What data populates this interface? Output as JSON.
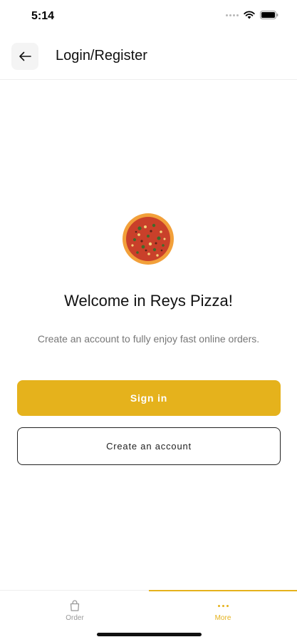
{
  "status_bar": {
    "time": "5:14"
  },
  "header": {
    "title": "Login/Register",
    "back_icon": "arrow-left-icon"
  },
  "main": {
    "logo": "pizza-logo",
    "welcome": "Welcome in Reys Pizza!",
    "subtitle": "Create an account to fully enjoy fast online orders.",
    "sign_in_label": "Sign in",
    "create_account_label": "Create an account"
  },
  "tabbar": {
    "tabs": [
      {
        "label": "Order",
        "icon": "shopping-bag-icon",
        "active": false
      },
      {
        "label": "More",
        "icon": "more-dots-icon",
        "active": true
      }
    ]
  },
  "colors": {
    "accent": "#e5b21c",
    "text": "#111111",
    "muted": "#777777"
  }
}
